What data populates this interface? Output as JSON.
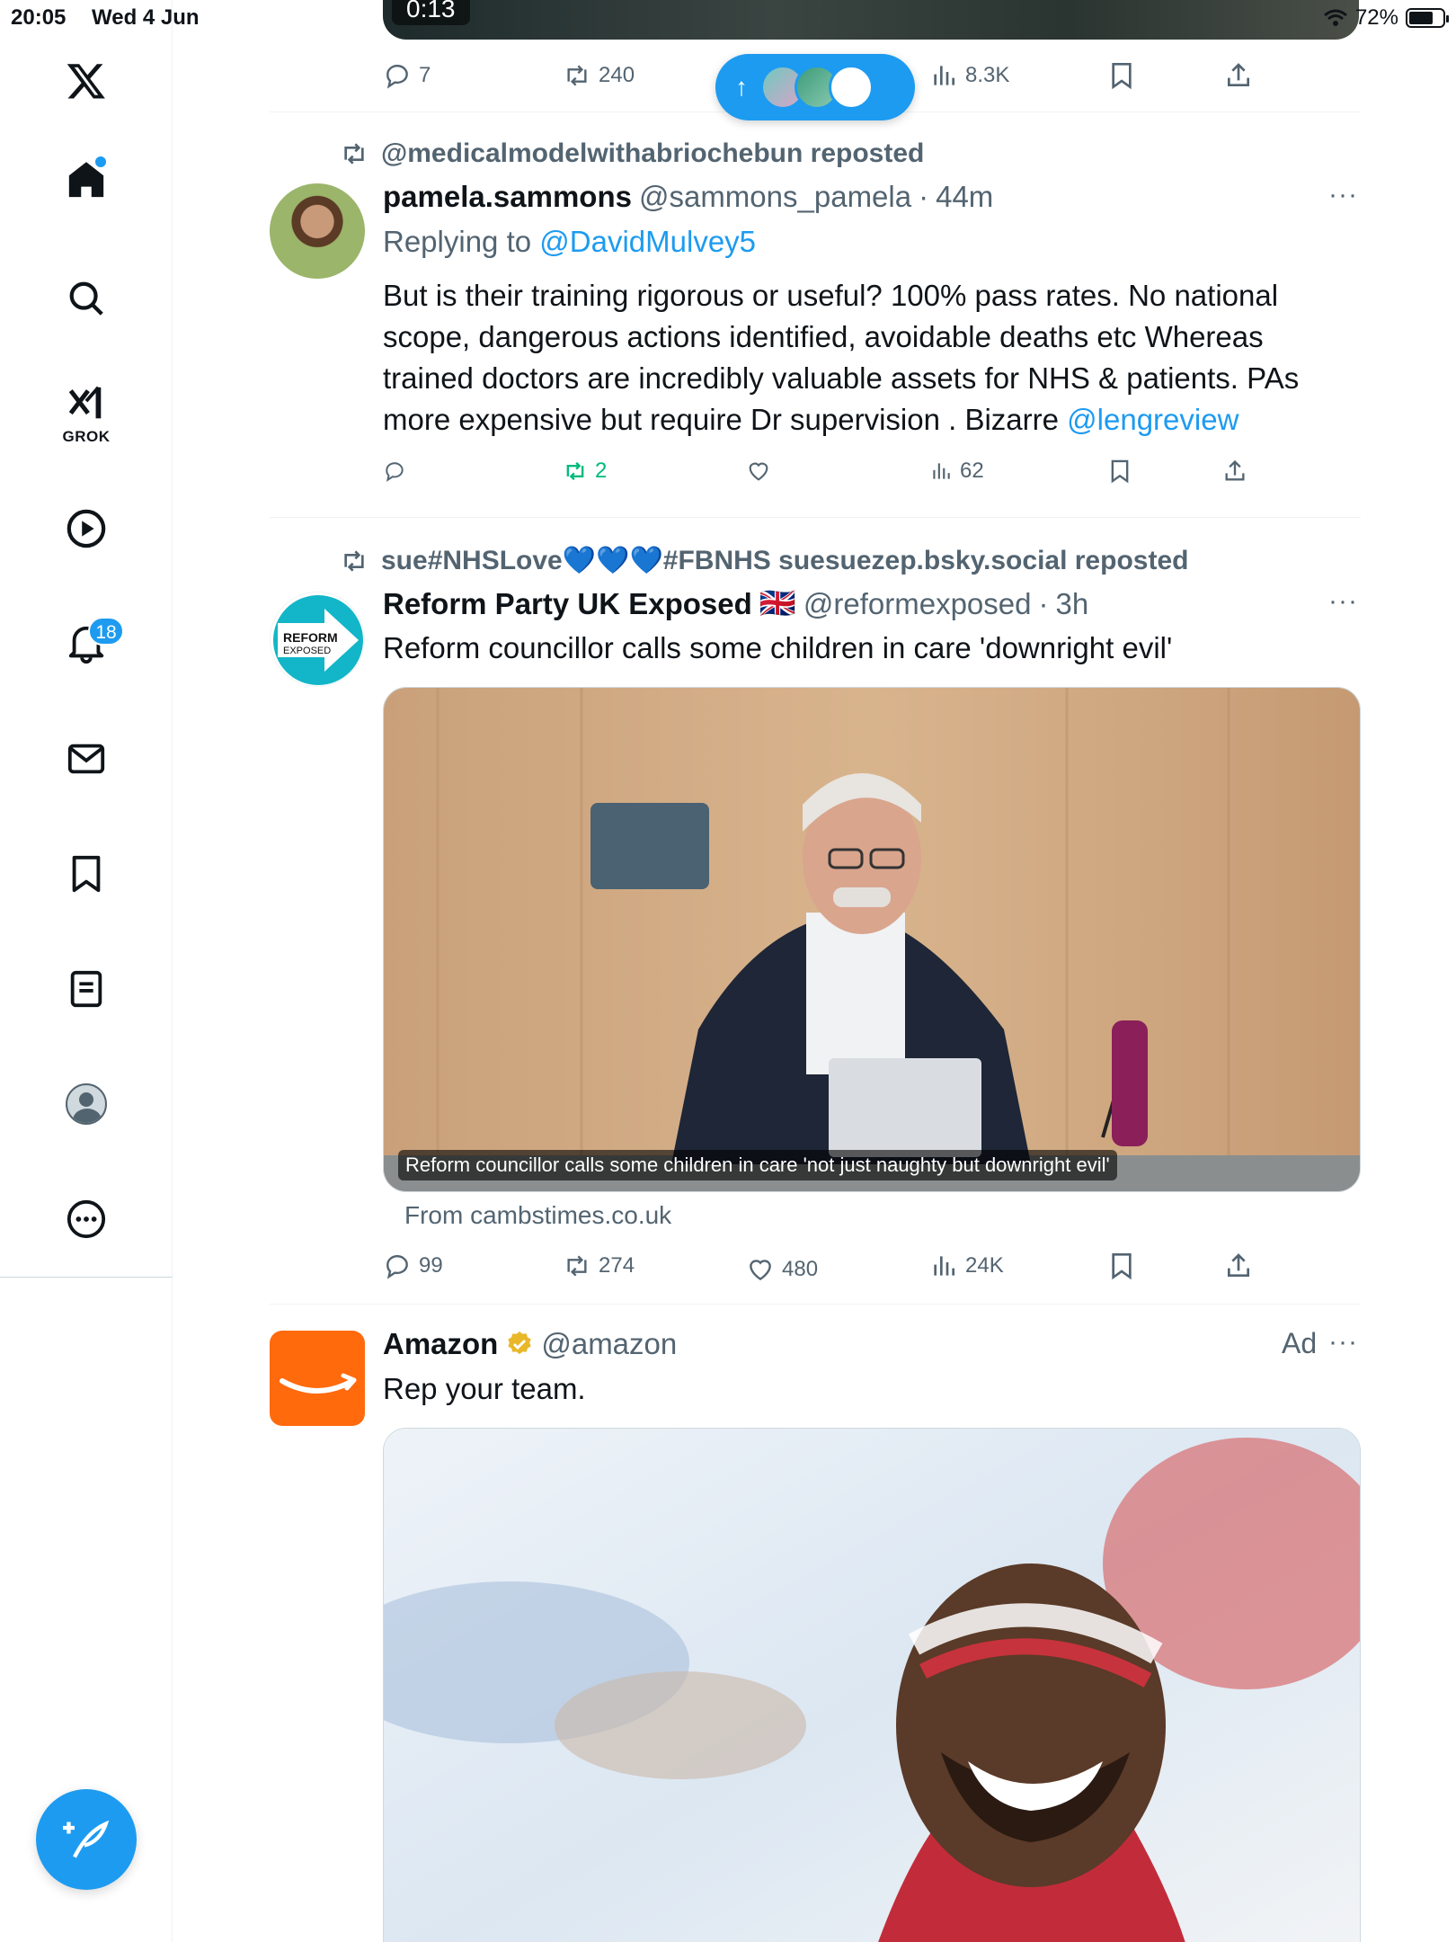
{
  "status_bar": {
    "time": "20:05",
    "date": "Wed 4 Jun",
    "battery": "72%",
    "battery_level": 0.72
  },
  "sidebar": {
    "items": [
      {
        "name": "home",
        "icon": "home-icon"
      },
      {
        "name": "search",
        "icon": "search-icon"
      },
      {
        "name": "grok",
        "icon": "grok-icon",
        "label": "GROK"
      },
      {
        "name": "video",
        "icon": "play-icon"
      },
      {
        "name": "notifications",
        "icon": "bell-icon",
        "badge": "18"
      },
      {
        "name": "messages",
        "icon": "envelope-icon"
      },
      {
        "name": "bookmarks",
        "icon": "bookmark-icon"
      },
      {
        "name": "lists",
        "icon": "list-icon"
      },
      {
        "name": "profile",
        "icon": "profile-icon"
      },
      {
        "name": "more",
        "icon": "more-circle-icon"
      }
    ]
  },
  "top_post": {
    "media_timer": "0:13",
    "replies": "7",
    "reposts": "240",
    "views": "8.3K"
  },
  "post1": {
    "reposted_by": "@medicalmodelwithabriochebun reposted",
    "name": "pamela.sammons",
    "handle": "@sammons_pamela",
    "time": "44m",
    "replying_prefix": "Replying to",
    "replying_to": "@DavidMulvey5",
    "text": "But is their training rigorous or useful? 100% pass rates. No national scope, dangerous actions identified,  avoidable deaths etc Whereas trained doctors are incredibly valuable assets for NHS & patients.  PAs more expensive but require Dr supervision . Bizarre",
    "mention": "@lengreview",
    "replies": "",
    "reposts": "2",
    "likes": "",
    "views": "62"
  },
  "post2": {
    "reposted_by": "sue#NHSLove💙💙💙#FBNHS suesuezep.bsky.social reposted",
    "name": "Reform Party UK Exposed",
    "flag": "🇬🇧",
    "handle": "@reformexposed",
    "time": "3h",
    "text": "Reform councillor calls some children in care 'downright evil'",
    "avatar_text_1": "REFORM",
    "avatar_text_2": "EXPOSED",
    "media_caption": "Reform councillor calls some children in care 'not just naughty but downright evil'",
    "card_source": "From cambstimes.co.uk",
    "replies": "99",
    "reposts": "274",
    "likes": "480",
    "views": "24K"
  },
  "post3": {
    "name": "Amazon",
    "handle": "@amazon",
    "ad_label": "Ad",
    "text": "Rep your team."
  },
  "new_posts_pill": {
    "arrow": "↑"
  },
  "colors": {
    "accent": "#1d9bf0",
    "repost_green": "#00ba7c",
    "secondary_text": "#536471",
    "amazon_orange": "#ff6a0d"
  }
}
